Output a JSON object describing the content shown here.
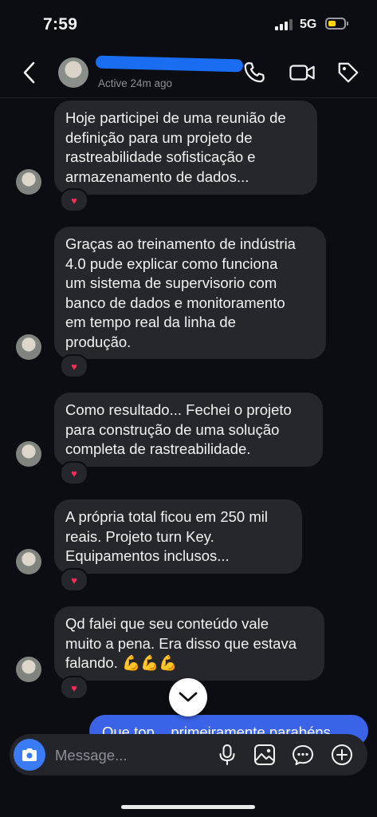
{
  "status_bar": {
    "time": "7:59",
    "network": "5G",
    "battery_color": "#ffd400"
  },
  "header": {
    "presence": "Active 24m ago"
  },
  "messages": [
    {
      "text": "Hoje participei de uma reunião de\ndefinição para um projeto de\nrastreabilidade sofisticação e\narmazenamento de dados...",
      "reaction": "♥"
    },
    {
      "text": "Graças ao treinamento de indústria\n4.0 pude explicar como funciona\num sistema de supervisorio com\nbanco de dados e monitoramento\nem tempo real da linha de\nprodução.",
      "reaction": "♥"
    },
    {
      "text": "Como resultado... Fechei o projeto\npara construção de uma solução\ncompleta de rastreabilidade.",
      "reaction": "♥"
    },
    {
      "text": "A própria total ficou em 250 mil\nreais. Projeto turn Key.\nEquipamentos inclusos...",
      "reaction": "♥"
    },
    {
      "text": "Qd falei que seu conteúdo vale\nmuito a pena. Era disso que estava\nfalando. 💪💪💪",
      "reaction": "♥"
    }
  ],
  "outgoing_partial": "Que top... primeiramente parabéns",
  "composer": {
    "placeholder": "Message..."
  },
  "colors": {
    "incoming_bubble": "#26272d",
    "outgoing_bubble": "#3a63e8",
    "accent": "#3b7bf6",
    "reaction": "#ff2b55"
  },
  "icons": [
    "back-arrow-icon",
    "phone-icon",
    "video-camera-icon",
    "tag-icon",
    "chevron-down-icon",
    "camera-icon",
    "microphone-icon",
    "image-icon",
    "sticker-icon",
    "plus-icon"
  ]
}
